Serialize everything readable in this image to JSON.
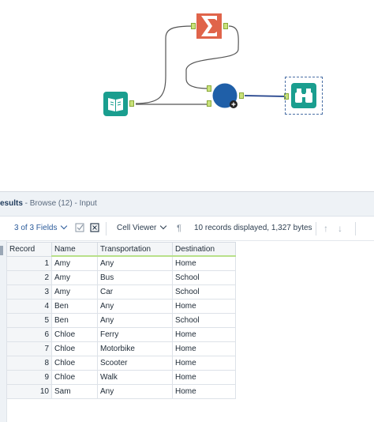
{
  "results": {
    "title_bold": "esults",
    "title_rest": " - Browse (12) - Input"
  },
  "toolbar": {
    "fields_label": "3 of 3 Fields",
    "cell_viewer_label": "Cell Viewer",
    "status": "10 records displayed, 1,327 bytes"
  },
  "table": {
    "columns": [
      "Record",
      "Name",
      "Transportation",
      "Destination"
    ],
    "rows": [
      [
        "1",
        "Amy",
        "Any",
        "Home"
      ],
      [
        "2",
        "Amy",
        "Bus",
        "School"
      ],
      [
        "3",
        "Amy",
        "Car",
        "School"
      ],
      [
        "4",
        "Ben",
        "Any",
        "Home"
      ],
      [
        "5",
        "Ben",
        "Any",
        "School"
      ],
      [
        "6",
        "Chloe",
        "Ferry",
        "Home"
      ],
      [
        "7",
        "Chloe",
        "Motorbike",
        "Home"
      ],
      [
        "8",
        "Chloe",
        "Scooter",
        "Home"
      ],
      [
        "9",
        "Chloe",
        "Walk",
        "Home"
      ],
      [
        "10",
        "Sam",
        "Any",
        "Home"
      ]
    ]
  },
  "colors": {
    "input_tool": "#1a9e8f",
    "summarize_tool": "#e0644a",
    "join_tool": "#1f5fa8",
    "browse_tool": "#1a9e8f",
    "anchor": "#c9e27a",
    "connector": "#555555"
  }
}
